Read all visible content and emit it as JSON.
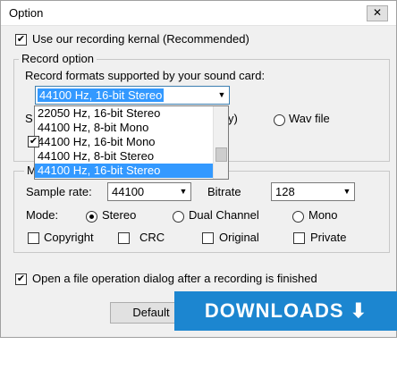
{
  "window": {
    "title": "Option",
    "close_label": "✕"
  },
  "use_kernel": {
    "label": "Use our recording kernal (Recommended)",
    "checked": true
  },
  "record_option": {
    "group_title": "Record option",
    "formats_label": "Record formats supported by your sound card:",
    "selected_format": "44100 Hz, 16-bit Stereo",
    "dropdown_options": [
      "22050 Hz, 16-bit Stereo",
      "44100 Hz, 8-bit Mono",
      "44100 Hz, 16-bit Mono",
      "44100 Hz, 8-bit Stereo",
      "44100 Hz, 16-bit Stereo"
    ],
    "partial_label_s": "S",
    "partial_label_y": "y)",
    "wav_file_label": "Wav file"
  },
  "mp3": {
    "group_title_partial": "M",
    "sample_rate_label": "Sample rate:",
    "sample_rate_value": "44100",
    "bitrate_label": "Bitrate",
    "bitrate_value": "128",
    "mode_label": "Mode:",
    "modes": [
      "Stereo",
      "Dual Channel",
      "Mono"
    ],
    "selected_mode": "Stereo",
    "flags": [
      "Copyright",
      "CRC",
      "Original",
      "Private"
    ]
  },
  "open_dialog": {
    "label": "Open a file operation dialog after a recording is finished",
    "checked": true
  },
  "buttons": {
    "default_label": "Default"
  },
  "watermark": {
    "text": "DOWNLOADS ⬇ GURU"
  },
  "colors": {
    "selection": "#3399ff",
    "watermark_bg": "#1c86d0"
  }
}
